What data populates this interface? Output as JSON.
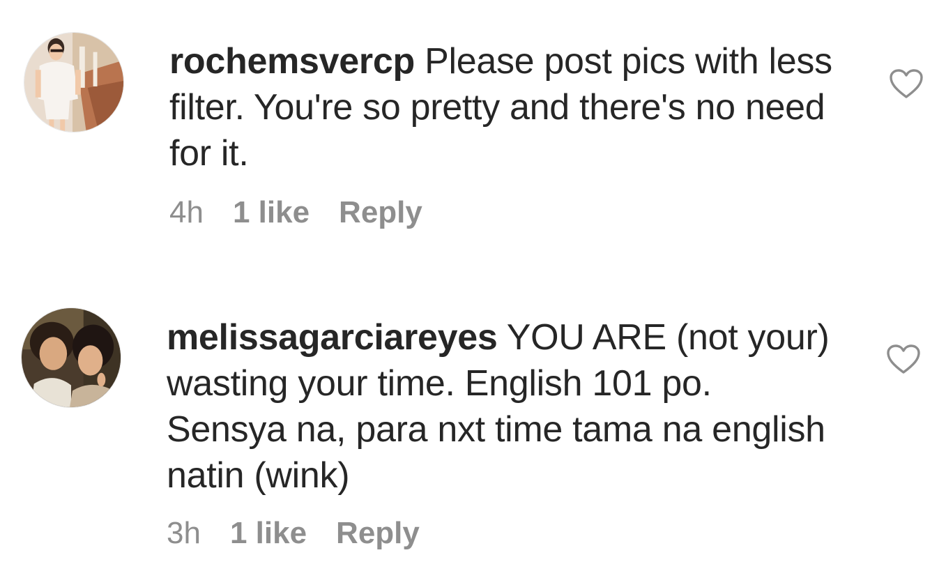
{
  "comments": [
    {
      "username": "rochemsvercp",
      "text": "Please post pics with less filter. You're so pretty and there's no need for it.",
      "time": "4h",
      "likes": "1 like",
      "reply_label": "Reply",
      "avatar_icon": "profile-photo",
      "like_icon": "heart-outline-icon"
    },
    {
      "username": "melissagarciareyes",
      "text": "YOU ARE (not your) wasting your time. English 101 po. Sensya na, para nxt time tama na english natin (wink)",
      "time": "3h",
      "likes": "1 like",
      "reply_label": "Reply",
      "avatar_icon": "profile-photo",
      "like_icon": "heart-outline-icon"
    }
  ],
  "colors": {
    "text_primary": "#262626",
    "text_secondary": "#8e8e8e",
    "background": "#ffffff"
  }
}
